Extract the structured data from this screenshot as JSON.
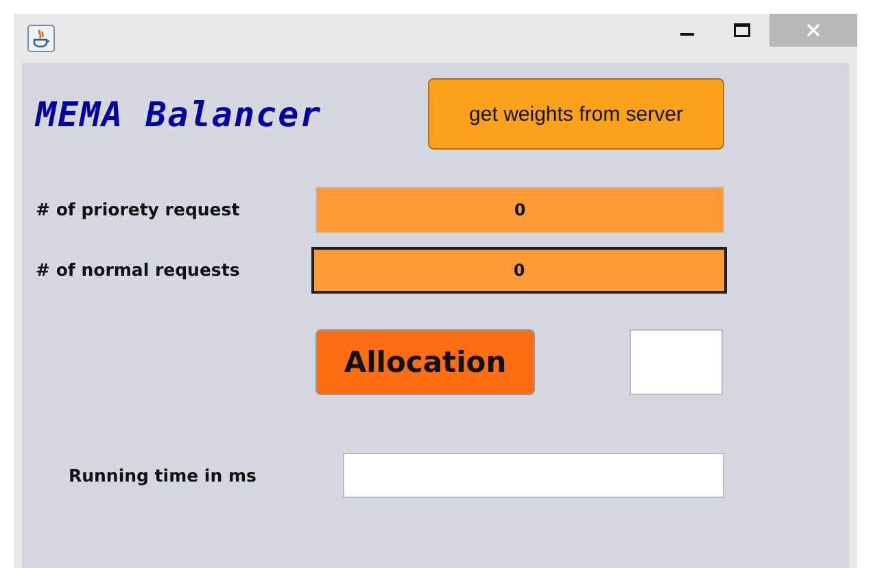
{
  "title": "MEMA Balancer",
  "fetch_button": "get weights from server",
  "fields": [
    {
      "label": "# of priorety request",
      "value": "0",
      "focused": false
    },
    {
      "label": "# of normal requests",
      "value": "0",
      "focused": true
    }
  ],
  "allocation_button": "Allocation",
  "running_time": {
    "label": "Running time in ms"
  }
}
